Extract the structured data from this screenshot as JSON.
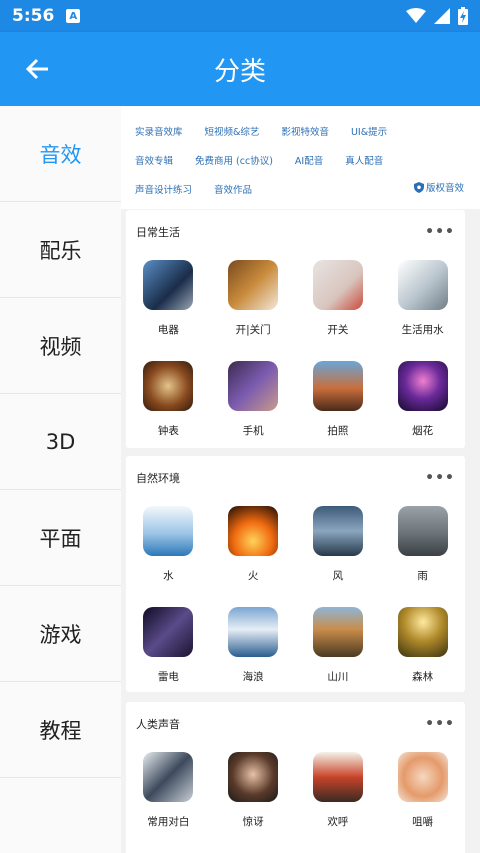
{
  "status": {
    "time": "5:56",
    "notif": "A"
  },
  "appbar": {
    "title": "分类"
  },
  "sidebar": {
    "items": [
      {
        "label": "音效"
      },
      {
        "label": "配乐"
      },
      {
        "label": "视频"
      },
      {
        "label": "3D"
      },
      {
        "label": "平面"
      },
      {
        "label": "游戏"
      },
      {
        "label": "教程"
      }
    ]
  },
  "tags": {
    "row1": [
      "实录音效库",
      "短视频&综艺",
      "影视特效音",
      "UI&提示"
    ],
    "row2": [
      "音效专辑",
      "免费商用 (cc协议)",
      "AI配音",
      "真人配音"
    ],
    "row3": [
      "声音设计练习",
      "音效作品"
    ],
    "copyright": "版权音效"
  },
  "sections": [
    {
      "title": "日常生活",
      "more": "•••",
      "items": [
        "电器",
        "开|关门",
        "开关",
        "生活用水",
        "钟表",
        "手机",
        "拍照",
        "烟花"
      ]
    },
    {
      "title": "自然环境",
      "more": "•••",
      "items": [
        "水",
        "火",
        "风",
        "雨",
        "雷电",
        "海浪",
        "山川",
        "森林"
      ]
    },
    {
      "title": "人类声音",
      "more": "•••",
      "items": [
        "常用对白",
        "惊讶",
        "欢呼",
        "咀嚼"
      ]
    }
  ],
  "colors": {
    "primary": "#2196f3",
    "tag_text": "#2c6fb5"
  }
}
